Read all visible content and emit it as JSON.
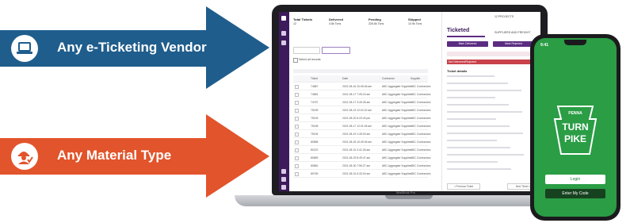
{
  "arrows": [
    {
      "label": "Any e-Ticketing Vendor",
      "color": "#1f5d8c",
      "icon": "laptop-icon"
    },
    {
      "label": "Any Material Type",
      "color": "#e2542b",
      "icon": "worker-check-icon"
    }
  ],
  "laptop": {
    "brand": "MacBook Pro",
    "summary": [
      {
        "label": "Total Tickets",
        "value": "12"
      },
      {
        "label": "Delivered",
        "value": "4.8k Tons"
      },
      {
        "label": "Pending",
        "value": "326.6k Tons"
      },
      {
        "label": "Shipped",
        "value": "13.9k Tons"
      }
    ],
    "select_all": "Select all records",
    "table_headers": [
      "Ticket",
      "Date",
      "Contractor",
      "Supplier"
    ],
    "rows": [
      [
        "74887",
        "2021-08-16 10:05:46 am",
        "ABC Aggregate Supplier",
        "ABC Contractors"
      ],
      [
        "74881",
        "2021-08-17 7:05:24 am",
        "ABC Aggregate Supplier",
        "ABC Contractors"
      ],
      [
        "74757",
        "2021-08-17 3:26:35 am",
        "ABC Aggregate Supplier",
        "ABC Contractors"
      ],
      [
        "75199",
        "2021-08-19 12:02:22 am",
        "ABC Aggregate Supplier",
        "ABC Contractors"
      ],
      [
        "75193",
        "2021-08-20 6:23:40 pm",
        "ABC Aggregate Supplier",
        "ABC Contractors"
      ],
      [
        "75198",
        "2021-08-17 12:01:06 am",
        "ABC Aggregate Supplier",
        "ABC Contractors"
      ],
      [
        "75194",
        "2021-08-19 1:28:00 am",
        "ABC Aggregate Supplier",
        "ABC Contractors"
      ],
      [
        "80858",
        "2021-08-25 10:49:46 am",
        "ABC Aggregate Supplier",
        "ABC Contractors"
      ],
      [
        "80222",
        "2021-08-31 3:41:26 am",
        "ABC Aggregate Supplier",
        "ABC Contractors"
      ],
      [
        "80859",
        "2021-08-29 8:49:47 am",
        "ABC Aggregate Supplier",
        "ABC Contractors"
      ],
      [
        "80860",
        "2021-08-30 7:55:27 am",
        "ABC Aggregate Supplier",
        "ABC Contractors"
      ],
      [
        "80769",
        "2021-08-31 6:33:04 am",
        "ABC Aggregate Supplier",
        "ABC Contractors"
      ]
    ],
    "detail_tab": "Ticketed",
    "detail_tab2": "SUPPLIERS AND FREIGHT",
    "detail_action1": "Mark Delivered",
    "detail_action2": "Mark Rejected",
    "detail_section": "Ticket details",
    "detail_alert": "Not Delivered/Rejected",
    "detail_prev": "< Previous Ticket",
    "detail_next": "Next Ticket >",
    "header_right": "12 PROJECTS"
  },
  "phone": {
    "status_time": "9:41",
    "logo_top": "PENNA",
    "logo_l1": "TURN",
    "logo_l2": "PIKE",
    "login": "Login",
    "secondary": "Enter My Code",
    "screen_color": "#2a9d45"
  }
}
